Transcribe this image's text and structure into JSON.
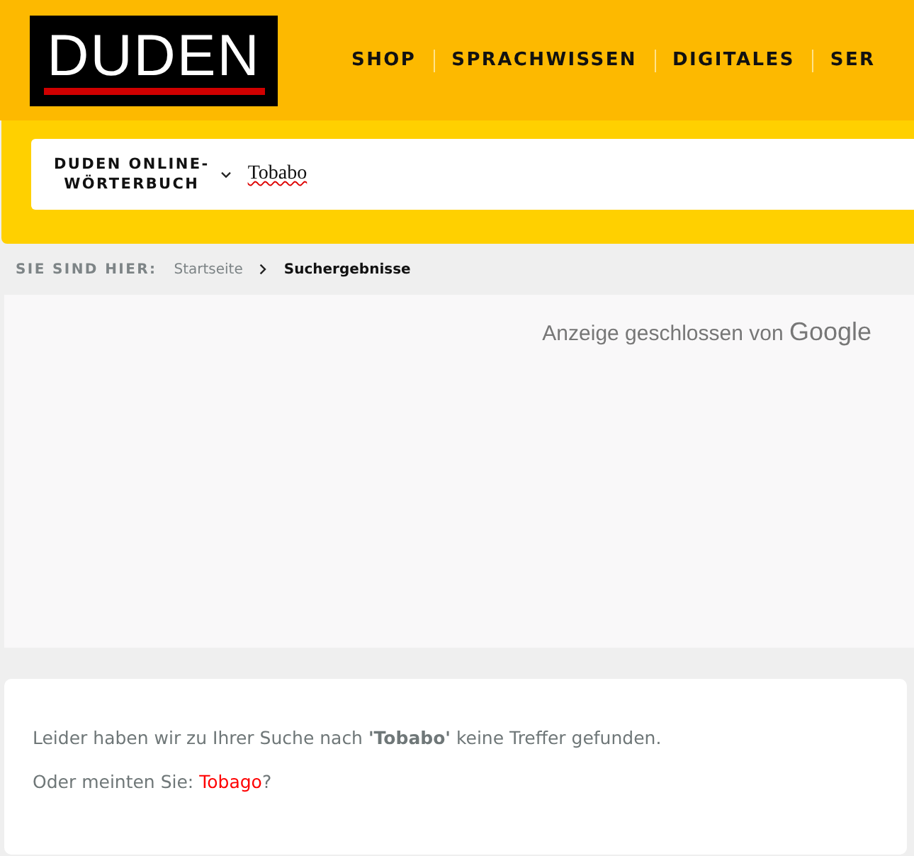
{
  "logo": {
    "text": "DUDEN"
  },
  "nav": [
    "SHOP",
    "SPRACHWISSEN",
    "DIGITALES",
    "SER"
  ],
  "search": {
    "dictionary": "DUDEN ONLINE-\nWÖRTERBUCH",
    "value": "Tobabo"
  },
  "breadcrumb": {
    "label": "SIE SIND HIER:",
    "items": [
      {
        "text": "Startseite",
        "current": false
      },
      {
        "text": "Suchergebnisse",
        "current": true
      }
    ]
  },
  "ad": {
    "notice": "Anzeige geschlossen von",
    "brand": "Google"
  },
  "result": {
    "message": "Leider haben wir zu Ihrer Suche nach **'Tobabo'** keine Treffer gefunden.",
    "suggestion_prefix": "Oder meinten Sie:",
    "suggestion": "Tobago",
    "suggestion_suffix": "?"
  }
}
